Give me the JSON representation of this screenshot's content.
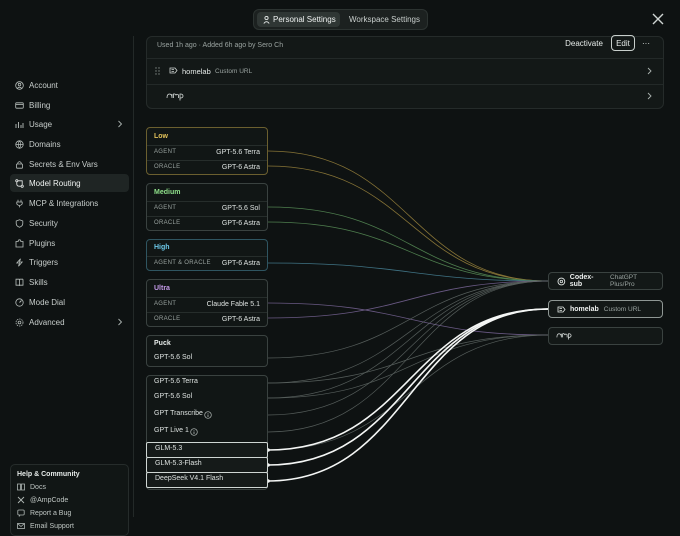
{
  "tabs": [
    {
      "label": "Personal Settings",
      "active": true,
      "icon": "person-icon"
    },
    {
      "label": "Workspace Settings",
      "active": false
    }
  ],
  "sidebar": {
    "items": [
      {
        "label": "Account",
        "icon": "user-circle-icon"
      },
      {
        "label": "Billing",
        "icon": "card-icon"
      },
      {
        "label": "Usage",
        "icon": "chart-icon",
        "expandable": true
      },
      {
        "label": "Domains",
        "icon": "globe-icon"
      },
      {
        "label": "Secrets & Env Vars",
        "icon": "lock-icon"
      },
      {
        "label": "Model Routing",
        "icon": "routing-icon",
        "active": true
      },
      {
        "label": "MCP & Integrations",
        "icon": "plug-icon"
      },
      {
        "label": "Security",
        "icon": "shield-icon"
      },
      {
        "label": "Plugins",
        "icon": "puzzle-icon"
      },
      {
        "label": "Triggers",
        "icon": "bolt-icon"
      },
      {
        "label": "Skills",
        "icon": "book-icon"
      },
      {
        "label": "Mode Dial",
        "icon": "dial-icon"
      },
      {
        "label": "Advanced",
        "icon": "settings-icon",
        "expandable": true
      }
    ],
    "help": {
      "title": "Help & Community",
      "links": [
        "Docs",
        "@AmpCode",
        "Report a Bug",
        "Email Support"
      ]
    }
  },
  "provider_card": {
    "used_text": "Used 1h ago · Added 6h ago by Sero Ch",
    "deactivate_label": "Deactivate",
    "edit_label": "Edit",
    "more_label": "···",
    "rows": [
      {
        "name": "homelab",
        "sub": "Custom URL"
      },
      {
        "name": "amp",
        "sub": ""
      }
    ]
  },
  "modes": [
    {
      "name": "Low",
      "color": "#e2c25a",
      "rows": [
        {
          "role": "AGENT",
          "model": "GPT-5.6 Terra"
        },
        {
          "role": "ORACLE",
          "model": "GPT-6 Astra"
        }
      ]
    },
    {
      "name": "Medium",
      "color": "#8fe08a",
      "rows": [
        {
          "role": "AGENT",
          "model": "GPT-5.6 Sol"
        },
        {
          "role": "ORACLE",
          "model": "GPT-6 Astra"
        }
      ]
    },
    {
      "name": "High",
      "color": "#6cc8e8",
      "rows": [
        {
          "role": "AGENT & ORACLE",
          "model": "GPT-6 Astra"
        }
      ]
    },
    {
      "name": "Ultra",
      "color": "#c49ae8",
      "rows": [
        {
          "role": "AGENT",
          "model": "Claude Fable 5.1"
        },
        {
          "role": "ORACLE",
          "model": "GPT-6 Astra"
        }
      ]
    }
  ],
  "puck": {
    "name": "Puck",
    "model": "GPT-5.6 Sol"
  },
  "models": [
    {
      "name": "GPT-5.6 Terra"
    },
    {
      "name": "GPT-5.6 Sol"
    },
    {
      "name": "GPT Transcribe",
      "info": true
    },
    {
      "name": "GPT Live 1",
      "info": true
    },
    {
      "name": "GLM-5.3",
      "selected": true
    },
    {
      "name": "GLM-5.3-Flash",
      "selected": true
    },
    {
      "name": "DeepSeek V4.1 Flash",
      "selected": true
    }
  ],
  "providers": [
    {
      "name": "Codex-sub",
      "sub": "ChatGPT Plus/Pro",
      "icon": "openai-icon"
    },
    {
      "name": "homelab",
      "sub": "Custom URL",
      "icon": "server-icon"
    },
    {
      "name": "amp",
      "sub": "",
      "icon": "amp-logo"
    }
  ]
}
